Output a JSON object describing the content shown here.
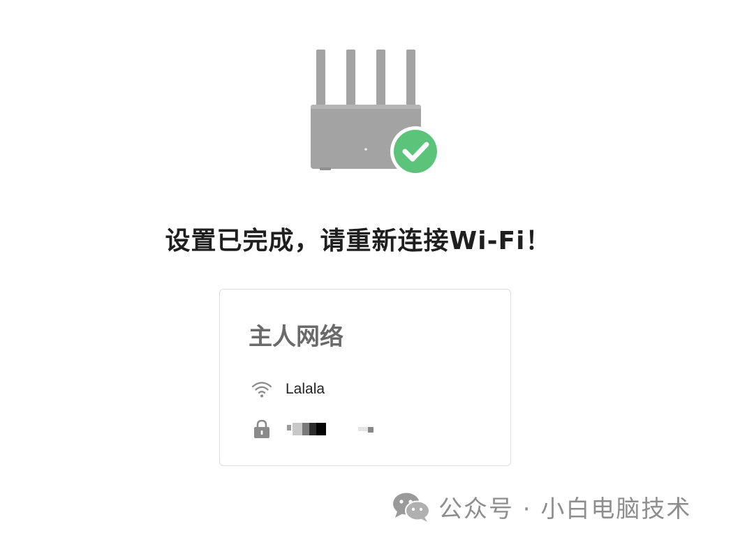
{
  "status": {
    "headline": "设置已完成，请重新连接Wi-Fi！"
  },
  "network_card": {
    "title": "主人网络",
    "ssid": "Lalala",
    "password_redacted": true
  },
  "watermark": {
    "text": "公众号 · 小白电脑技术"
  },
  "icons": {
    "router": "router-icon",
    "success": "check-circle-icon",
    "wifi": "wifi-icon",
    "lock": "lock-icon",
    "wechat": "wechat-icon"
  },
  "colors": {
    "router_gray": "#a3a3a3",
    "success_green": "#5cc47a",
    "card_border": "#dcdcdc",
    "title_gray": "#6a6a6a",
    "watermark_gray": "#8e8e8e"
  }
}
